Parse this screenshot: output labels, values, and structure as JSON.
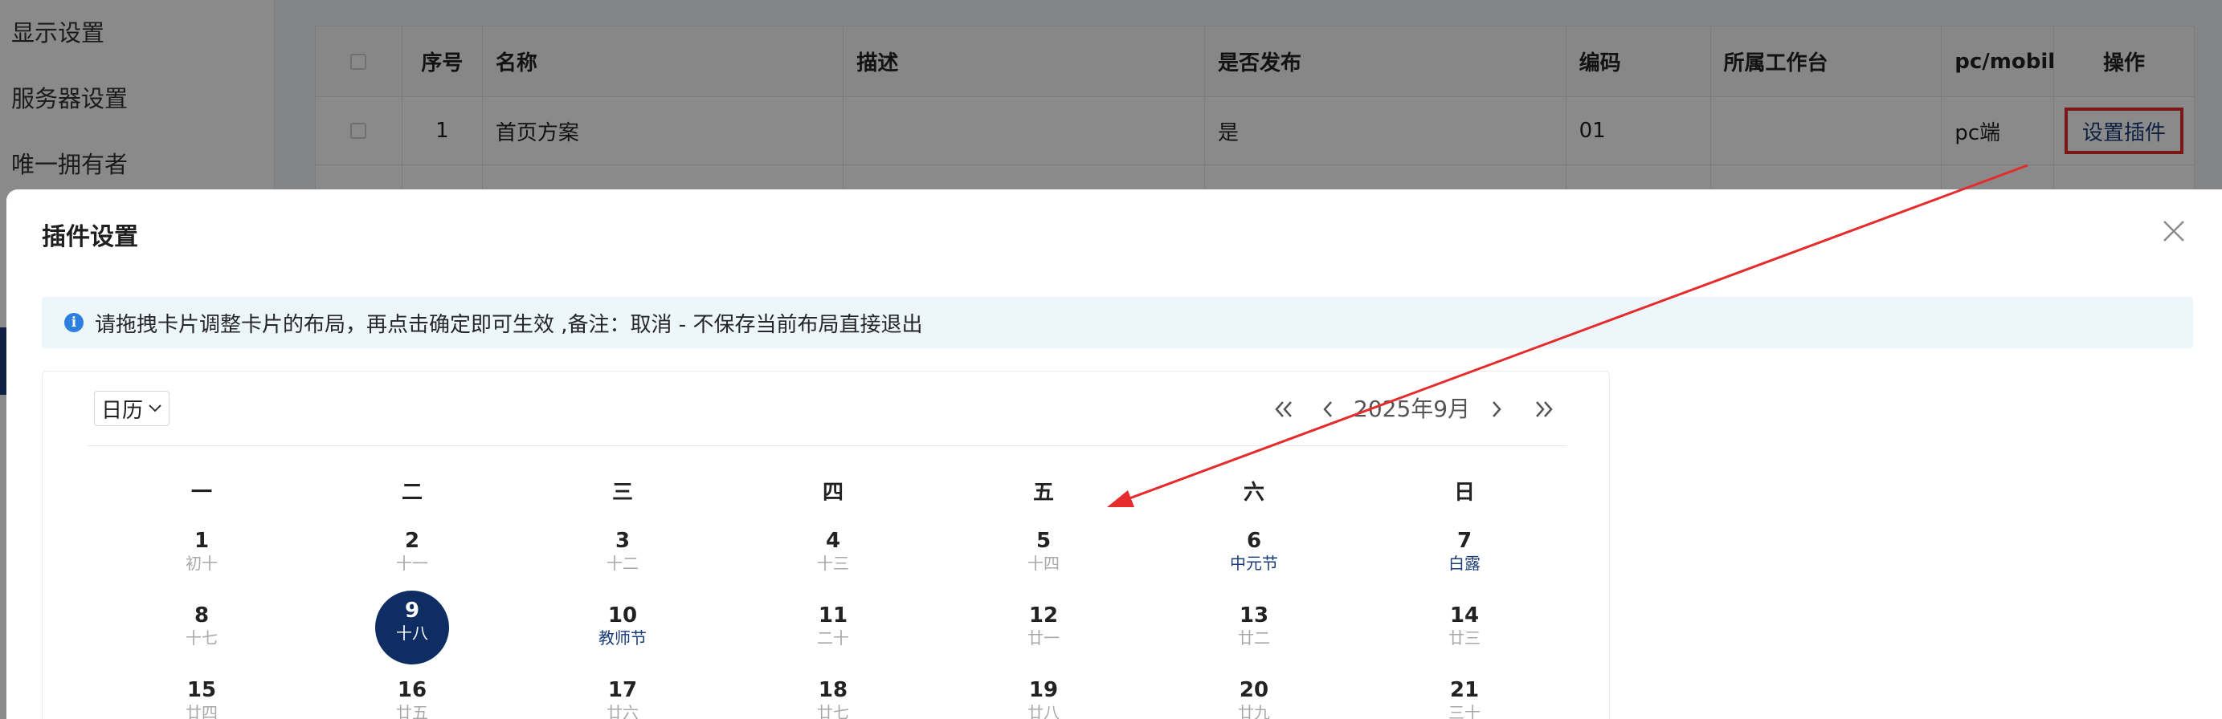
{
  "sidebar": {
    "items": [
      {
        "label": "显示设置"
      },
      {
        "label": "服务器设置"
      },
      {
        "label": "唯一拥有者"
      }
    ]
  },
  "table": {
    "headers": {
      "index": "序号",
      "name": "名称",
      "description": "描述",
      "published": "是否发布",
      "code": "编码",
      "workbench": "所属工作台",
      "platform": "pc/mobile",
      "actions": "操作"
    },
    "rows": [
      {
        "index": "1",
        "name": "首页方案",
        "description": "",
        "published": "是",
        "code": "01",
        "workbench": "",
        "platform": "pc端",
        "action_label": "设置插件"
      }
    ]
  },
  "modal": {
    "title": "插件设置",
    "alert": "请拖拽卡片调整卡片的布局，再点击确定即可生效 ,备注：取消 - 不保存当前布局直接退出",
    "calendar": {
      "mode": "日历",
      "month_label": "2025年9月",
      "weekdays": [
        "一",
        "二",
        "三",
        "四",
        "五",
        "六",
        "日"
      ],
      "selected_day": "9",
      "weeks": [
        [
          {
            "day": "1",
            "lunar": "初十",
            "festival": false
          },
          {
            "day": "2",
            "lunar": "十一",
            "festival": false
          },
          {
            "day": "3",
            "lunar": "十二",
            "festival": false
          },
          {
            "day": "4",
            "lunar": "十三",
            "festival": false
          },
          {
            "day": "5",
            "lunar": "十四",
            "festival": false
          },
          {
            "day": "6",
            "lunar": "中元节",
            "festival": true
          },
          {
            "day": "7",
            "lunar": "白露",
            "festival": true
          }
        ],
        [
          {
            "day": "8",
            "lunar": "十七",
            "festival": false
          },
          {
            "day": "9",
            "lunar": "十八",
            "festival": false
          },
          {
            "day": "10",
            "lunar": "教师节",
            "festival": true
          },
          {
            "day": "11",
            "lunar": "二十",
            "festival": false
          },
          {
            "day": "12",
            "lunar": "廿一",
            "festival": false
          },
          {
            "day": "13",
            "lunar": "廿二",
            "festival": false
          },
          {
            "day": "14",
            "lunar": "廿三",
            "festival": false
          }
        ],
        [
          {
            "day": "15",
            "lunar": "廿四",
            "festival": false
          },
          {
            "day": "16",
            "lunar": "廿五",
            "festival": false
          },
          {
            "day": "17",
            "lunar": "廿六",
            "festival": false
          },
          {
            "day": "18",
            "lunar": "廿七",
            "festival": false
          },
          {
            "day": "19",
            "lunar": "廿八",
            "festival": false
          },
          {
            "day": "20",
            "lunar": "廿九",
            "festival": false
          },
          {
            "day": "21",
            "lunar": "三十",
            "festival": false
          }
        ]
      ]
    }
  },
  "colors": {
    "accent": "#0e2d63",
    "festival": "#1a3d7a",
    "annotation": "#e52b2b",
    "alert_bg": "#ecf6fb",
    "info_icon": "#2d7fe0"
  }
}
